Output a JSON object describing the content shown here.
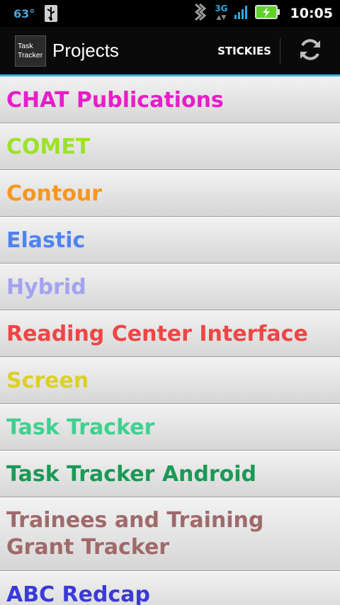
{
  "status_bar": {
    "temperature": "63°",
    "network": "3G",
    "time": "10:05"
  },
  "action_bar": {
    "logo_line1": "Task",
    "logo_line2": "Tracker",
    "title": "Projects",
    "stickies_label": "STICKIES",
    "refresh_icon": "refresh-icon"
  },
  "projects": [
    {
      "name": "CHAT Publications",
      "color": "#e61ec8"
    },
    {
      "name": "COMET",
      "color": "#9ce22a"
    },
    {
      "name": "Contour",
      "color": "#f7961e"
    },
    {
      "name": "Elastic",
      "color": "#4f83f0"
    },
    {
      "name": "Hybrid",
      "color": "#a3a3f0"
    },
    {
      "name": "Reading Center Interface",
      "color": "#f04545"
    },
    {
      "name": "Screen",
      "color": "#dcd028"
    },
    {
      "name": "Task Tracker",
      "color": "#40d090"
    },
    {
      "name": "Task Tracker Android",
      "color": "#1a9a55"
    },
    {
      "name": "Trainees and Training Grant Tracker",
      "color": "#a06a6a"
    },
    {
      "name": "ABC Redcap",
      "color": "#3a3ad8"
    }
  ]
}
